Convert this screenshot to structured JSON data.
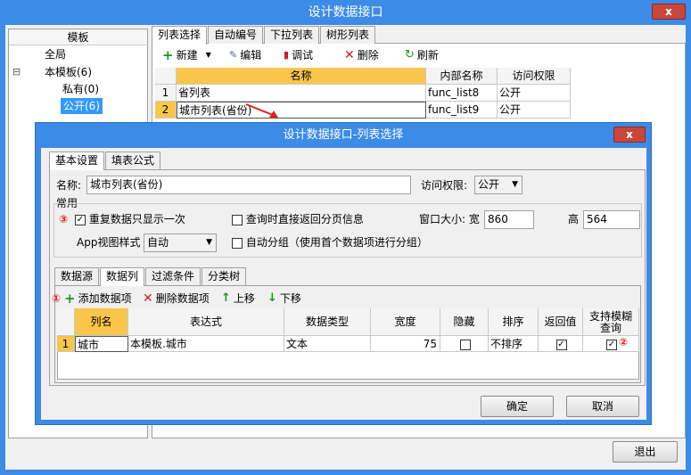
{
  "main_window": {
    "title": "设计数据接口",
    "close_label": "x",
    "exit_label": "退出"
  },
  "left_panel": {
    "header": "模板",
    "tree": [
      {
        "label": "全局"
      },
      {
        "label": "本模板(6)",
        "toggle": "⊟"
      },
      {
        "label": "私有(0)"
      },
      {
        "label": "公开(6)",
        "selected": true
      }
    ]
  },
  "tabs": [
    "列表选择",
    "自动编号",
    "下拉列表",
    "树形列表"
  ],
  "toolbar": {
    "new": "新建",
    "edit": "编辑",
    "debug": "调试",
    "delete": "删除",
    "refresh": "刷新"
  },
  "top_grid": {
    "columns": [
      "名称",
      "内部名称",
      "访问权限"
    ],
    "rows": [
      {
        "num": "1",
        "name": "省列表",
        "internal": "func_list8",
        "access": "公开"
      },
      {
        "num": "2",
        "name": "城市列表(省份)",
        "internal": "func_list9",
        "access": "公开"
      }
    ]
  },
  "dialog": {
    "title": "设计数据接口-列表选择",
    "close_label": "x",
    "tabs": [
      "基本设置",
      "填表公式"
    ],
    "name_label": "名称:",
    "name_value": "城市列表(省份)",
    "access_label": "访问权限:",
    "access_value": "公开",
    "common_label": "常用",
    "marker3": "③",
    "opt_dedupe": "重复数据只显示一次",
    "opt_page_info": "查询时直接返回分页信息",
    "window_size_label": "窗口大小: 宽",
    "width_value": "860",
    "height_label": "高",
    "height_value": "564",
    "app_view_label": "App视图样式",
    "app_view_value": "自动",
    "opt_auto_group": "自动分组（使用首个数据项进行分组）",
    "sub_tabs": [
      "数据源",
      "数据列",
      "过滤条件",
      "分类树"
    ],
    "marker1": "①",
    "sub_toolbar": {
      "add": "添加数据项",
      "remove": "删除数据项",
      "up": "上移",
      "down": "下移"
    },
    "grid": {
      "columns": [
        "列名",
        "表达式",
        "数据类型",
        "宽度",
        "隐藏",
        "排序",
        "返回值",
        "支持模糊查询"
      ],
      "rows": [
        {
          "num": "1",
          "col_name": "城市",
          "expr": "本模板.城市",
          "type": "文本",
          "width": "75",
          "hidden": false,
          "sort": "不排序",
          "return": true,
          "fuzzy": true
        }
      ]
    },
    "marker2": "②",
    "ok": "确定",
    "cancel": "取消"
  },
  "colors": {
    "titlebar": "#3c8be6",
    "close": "#c9463d",
    "selection": "#3399ff",
    "highlight_cell": "#f9c64c",
    "marker": "#e02020"
  }
}
